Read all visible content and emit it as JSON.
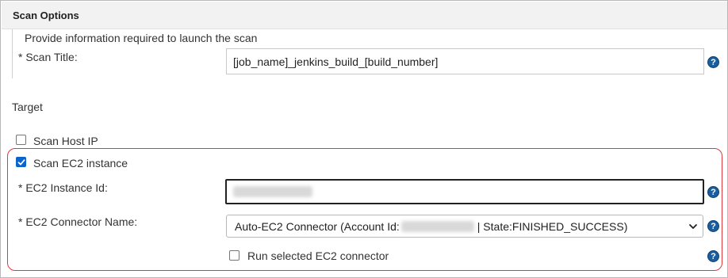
{
  "section": {
    "title": "Scan Options",
    "description": "Provide information required to launch the scan"
  },
  "scan_title": {
    "label": "* Scan Title:",
    "value": "[job_name]_jenkins_build_[build_number]",
    "help_glyph": "?"
  },
  "target": {
    "label": "Target"
  },
  "scan_host_ip": {
    "label": "Scan Host IP",
    "checked": false
  },
  "scan_ec2": {
    "label": "Scan EC2 instance",
    "checked": true
  },
  "ec2_instance_id": {
    "label": "* EC2 Instance Id:",
    "help_glyph": "?"
  },
  "ec2_connector": {
    "label": "* EC2 Connector Name:",
    "selected_prefix": "Auto-EC2 Connector (Account Id:",
    "selected_suffix": "| State:FINISHED_SUCCESS)",
    "help_glyph": "?"
  },
  "run_connector": {
    "label": "Run selected EC2 connector",
    "checked": false,
    "help_glyph": "?"
  },
  "colors": {
    "help_icon": "#1a5e9e",
    "checkbox_checked": "#0b63ce",
    "highlight_border": "#e0393e",
    "header_bg": "#f2f2f2"
  }
}
